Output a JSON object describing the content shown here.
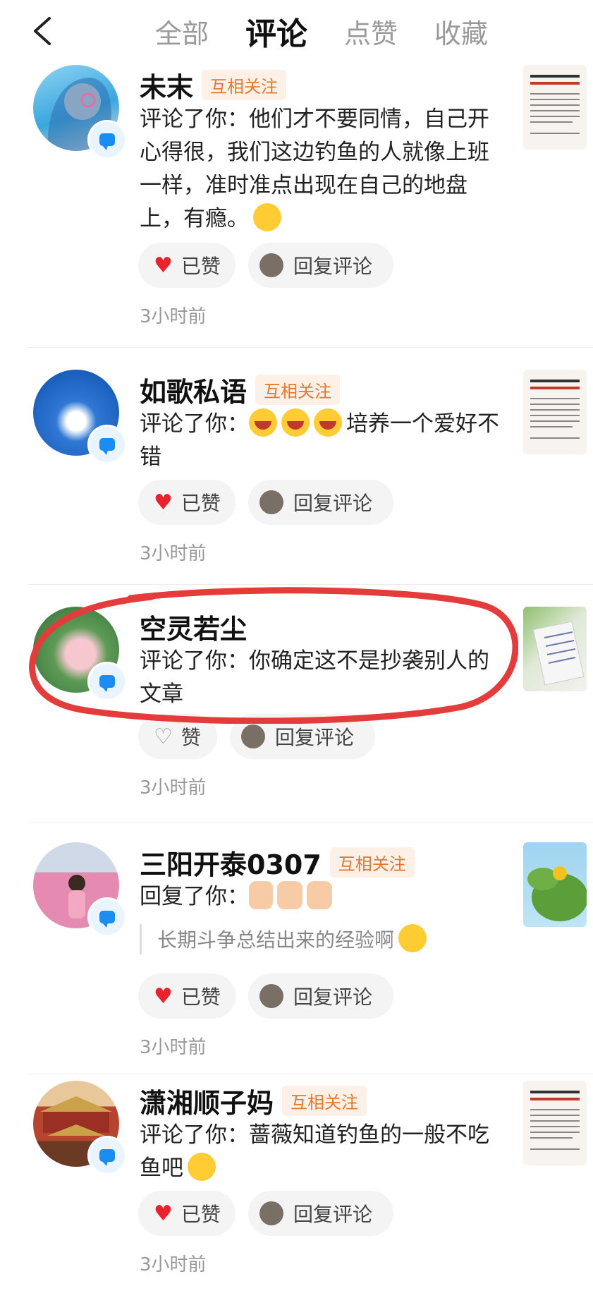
{
  "header": {
    "tabs": [
      {
        "label": "全部"
      },
      {
        "label": "评论"
      },
      {
        "label": "点赞"
      },
      {
        "label": "收藏"
      }
    ]
  },
  "items": [
    {
      "name": "未末",
      "badge": "互相关注",
      "prefix": "评论了你：",
      "text": "他们才不要同情，自己开心得很，我们这边钓鱼的人就像上班一样，准时准点出现在自己的地盘上，有瘾。",
      "like_label": "已赞",
      "reply_label": "回复评论",
      "time": "3小时前"
    },
    {
      "name": "如歌私语",
      "badge": "互相关注",
      "prefix": "评论了你：",
      "text": "培养一个爱好不错",
      "like_label": "已赞",
      "reply_label": "回复评论",
      "time": "3小时前"
    },
    {
      "name": "空灵若尘",
      "prefix": "评论了你：",
      "text": "你确定这不是抄袭别人的文章",
      "like_label": "赞",
      "reply_label": "回复评论",
      "time": "3小时前"
    },
    {
      "name": "三阳开泰0307",
      "badge": "互相关注",
      "prefix": "回复了你：",
      "quote": "长期斗争总结出来的经验啊",
      "like_label": "已赞",
      "reply_label": "回复评论",
      "time": "3小时前"
    },
    {
      "name": "潇湘顺子妈",
      "badge": "互相关注",
      "prefix": "评论了你：",
      "text": "蔷薇知道钓鱼的一般不吃鱼吧",
      "like_label": "已赞",
      "reply_label": "回复评论",
      "time": "3小时前"
    }
  ],
  "colors": {
    "liked_heart": "#e8232e",
    "mutual_badge_text": "#e2782e",
    "mutual_badge_bg": "#fdf0e6",
    "annotation_circle": "#e43b3b"
  }
}
